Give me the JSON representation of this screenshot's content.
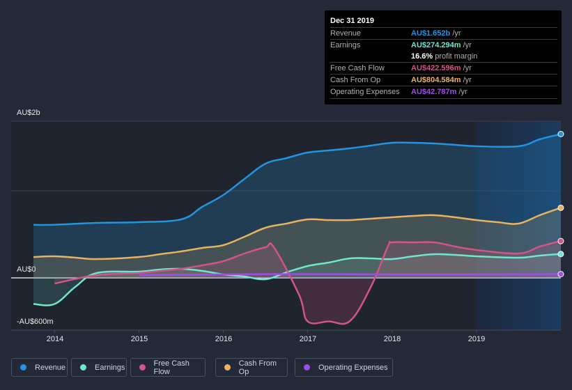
{
  "tooltip": {
    "date": "Dec 31 2019",
    "rows": [
      {
        "label": "Revenue",
        "value": "AU$1.652b",
        "unit": "/yr",
        "color": "#2394df"
      },
      {
        "label": "Earnings",
        "value": "AU$274.294m",
        "unit": "/yr",
        "color": "#6ee6d0"
      },
      {
        "label": "Free Cash Flow",
        "value": "AU$422.596m",
        "unit": "/yr",
        "color": "#d1548b"
      },
      {
        "label": "Cash From Op",
        "value": "AU$804.584m",
        "unit": "/yr",
        "color": "#e9b261"
      },
      {
        "label": "Operating Expenses",
        "value": "AU$42.787m",
        "unit": "/yr",
        "color": "#a04de6"
      }
    ],
    "profit_margin_value": "16.6%",
    "profit_margin_label": "profit margin"
  },
  "legend": [
    {
      "label": "Revenue",
      "color": "#2394df"
    },
    {
      "label": "Earnings",
      "color": "#6ee6d0"
    },
    {
      "label": "Free Cash Flow",
      "color": "#d1548b"
    },
    {
      "label": "Cash From Op",
      "color": "#e9b261"
    },
    {
      "label": "Operating Expenses",
      "color": "#a04de6"
    }
  ],
  "chart_data": {
    "type": "area",
    "title": "",
    "xlabel": "",
    "ylabel": "",
    "y_tick_labels": [
      "AU$2b",
      "AU$0",
      "-AU$600m"
    ],
    "x_tick_labels": [
      "2014",
      "2015",
      "2016",
      "2017",
      "2018",
      "2019"
    ],
    "xlim": [
      2013.75,
      2020.0
    ],
    "ylim_millions": [
      -600,
      1800
    ],
    "forecast_shaded_from": 2019.0,
    "grid": true,
    "series": [
      {
        "name": "Revenue",
        "color": "#2394df",
        "x": [
          2013.75,
          2014.0,
          2014.5,
          2015.0,
          2015.5,
          2015.75,
          2016.0,
          2016.25,
          2016.5,
          2016.75,
          2017.0,
          2017.25,
          2017.5,
          2017.75,
          2018.0,
          2018.25,
          2018.5,
          2018.75,
          2019.0,
          2019.5,
          2019.75,
          2020.0
        ],
        "values": [
          610,
          610,
          632,
          640,
          672,
          816,
          952,
          1136,
          1312,
          1376,
          1440,
          1464,
          1488,
          1520,
          1552,
          1552,
          1544,
          1528,
          1512,
          1512,
          1592,
          1652
        ]
      },
      {
        "name": "Earnings",
        "color": "#6ee6d0",
        "x": [
          2013.75,
          2014.0,
          2014.25,
          2014.5,
          2015.0,
          2015.25,
          2015.5,
          2015.75,
          2016.0,
          2016.25,
          2016.5,
          2016.75,
          2017.0,
          2017.25,
          2017.5,
          2017.75,
          2018.0,
          2018.25,
          2018.5,
          2018.75,
          2019.0,
          2019.5,
          2019.75,
          2020.0
        ],
        "values": [
          -300,
          -300,
          -100,
          56,
          72,
          96,
          104,
          80,
          40,
          16,
          -16,
          64,
          136,
          176,
          224,
          224,
          216,
          248,
          272,
          264,
          248,
          232,
          256,
          274
        ]
      },
      {
        "name": "Free Cash Flow",
        "color": "#d1548b",
        "x": [
          2014.0,
          2014.5,
          2015.0,
          2015.25,
          2015.5,
          2015.75,
          2016.0,
          2016.25,
          2016.5,
          2016.6,
          2016.9,
          2017.0,
          2017.25,
          2017.5,
          2017.75,
          2017.95,
          2018.0,
          2018.25,
          2018.5,
          2018.75,
          2019.0,
          2019.5,
          2019.75,
          2020.0
        ],
        "values": [
          -65,
          32,
          56,
          80,
          104,
          144,
          192,
          280,
          352,
          350,
          -200,
          -500,
          -500,
          -496,
          -100,
          360,
          408,
          408,
          408,
          360,
          320,
          280,
          360,
          423
        ]
      },
      {
        "name": "Cash From Op",
        "color": "#e9b261",
        "x": [
          2013.75,
          2014.0,
          2014.25,
          2014.5,
          2015.0,
          2015.25,
          2015.5,
          2015.75,
          2016.0,
          2016.25,
          2016.5,
          2016.75,
          2017.0,
          2017.25,
          2017.5,
          2017.75,
          2018.0,
          2018.25,
          2018.5,
          2018.75,
          2019.0,
          2019.25,
          2019.5,
          2019.75,
          2020.0
        ],
        "values": [
          240,
          248,
          232,
          216,
          240,
          272,
          304,
          344,
          376,
          472,
          576,
          624,
          672,
          664,
          664,
          680,
          696,
          712,
          720,
          696,
          664,
          640,
          624,
          720,
          805
        ]
      },
      {
        "name": "Operating Expenses",
        "color": "#a04de6",
        "x": [
          2015.0,
          2016.0,
          2017.0,
          2018.0,
          2019.0,
          2020.0
        ],
        "values": [
          32,
          40,
          44,
          40,
          40,
          43
        ]
      }
    ]
  }
}
